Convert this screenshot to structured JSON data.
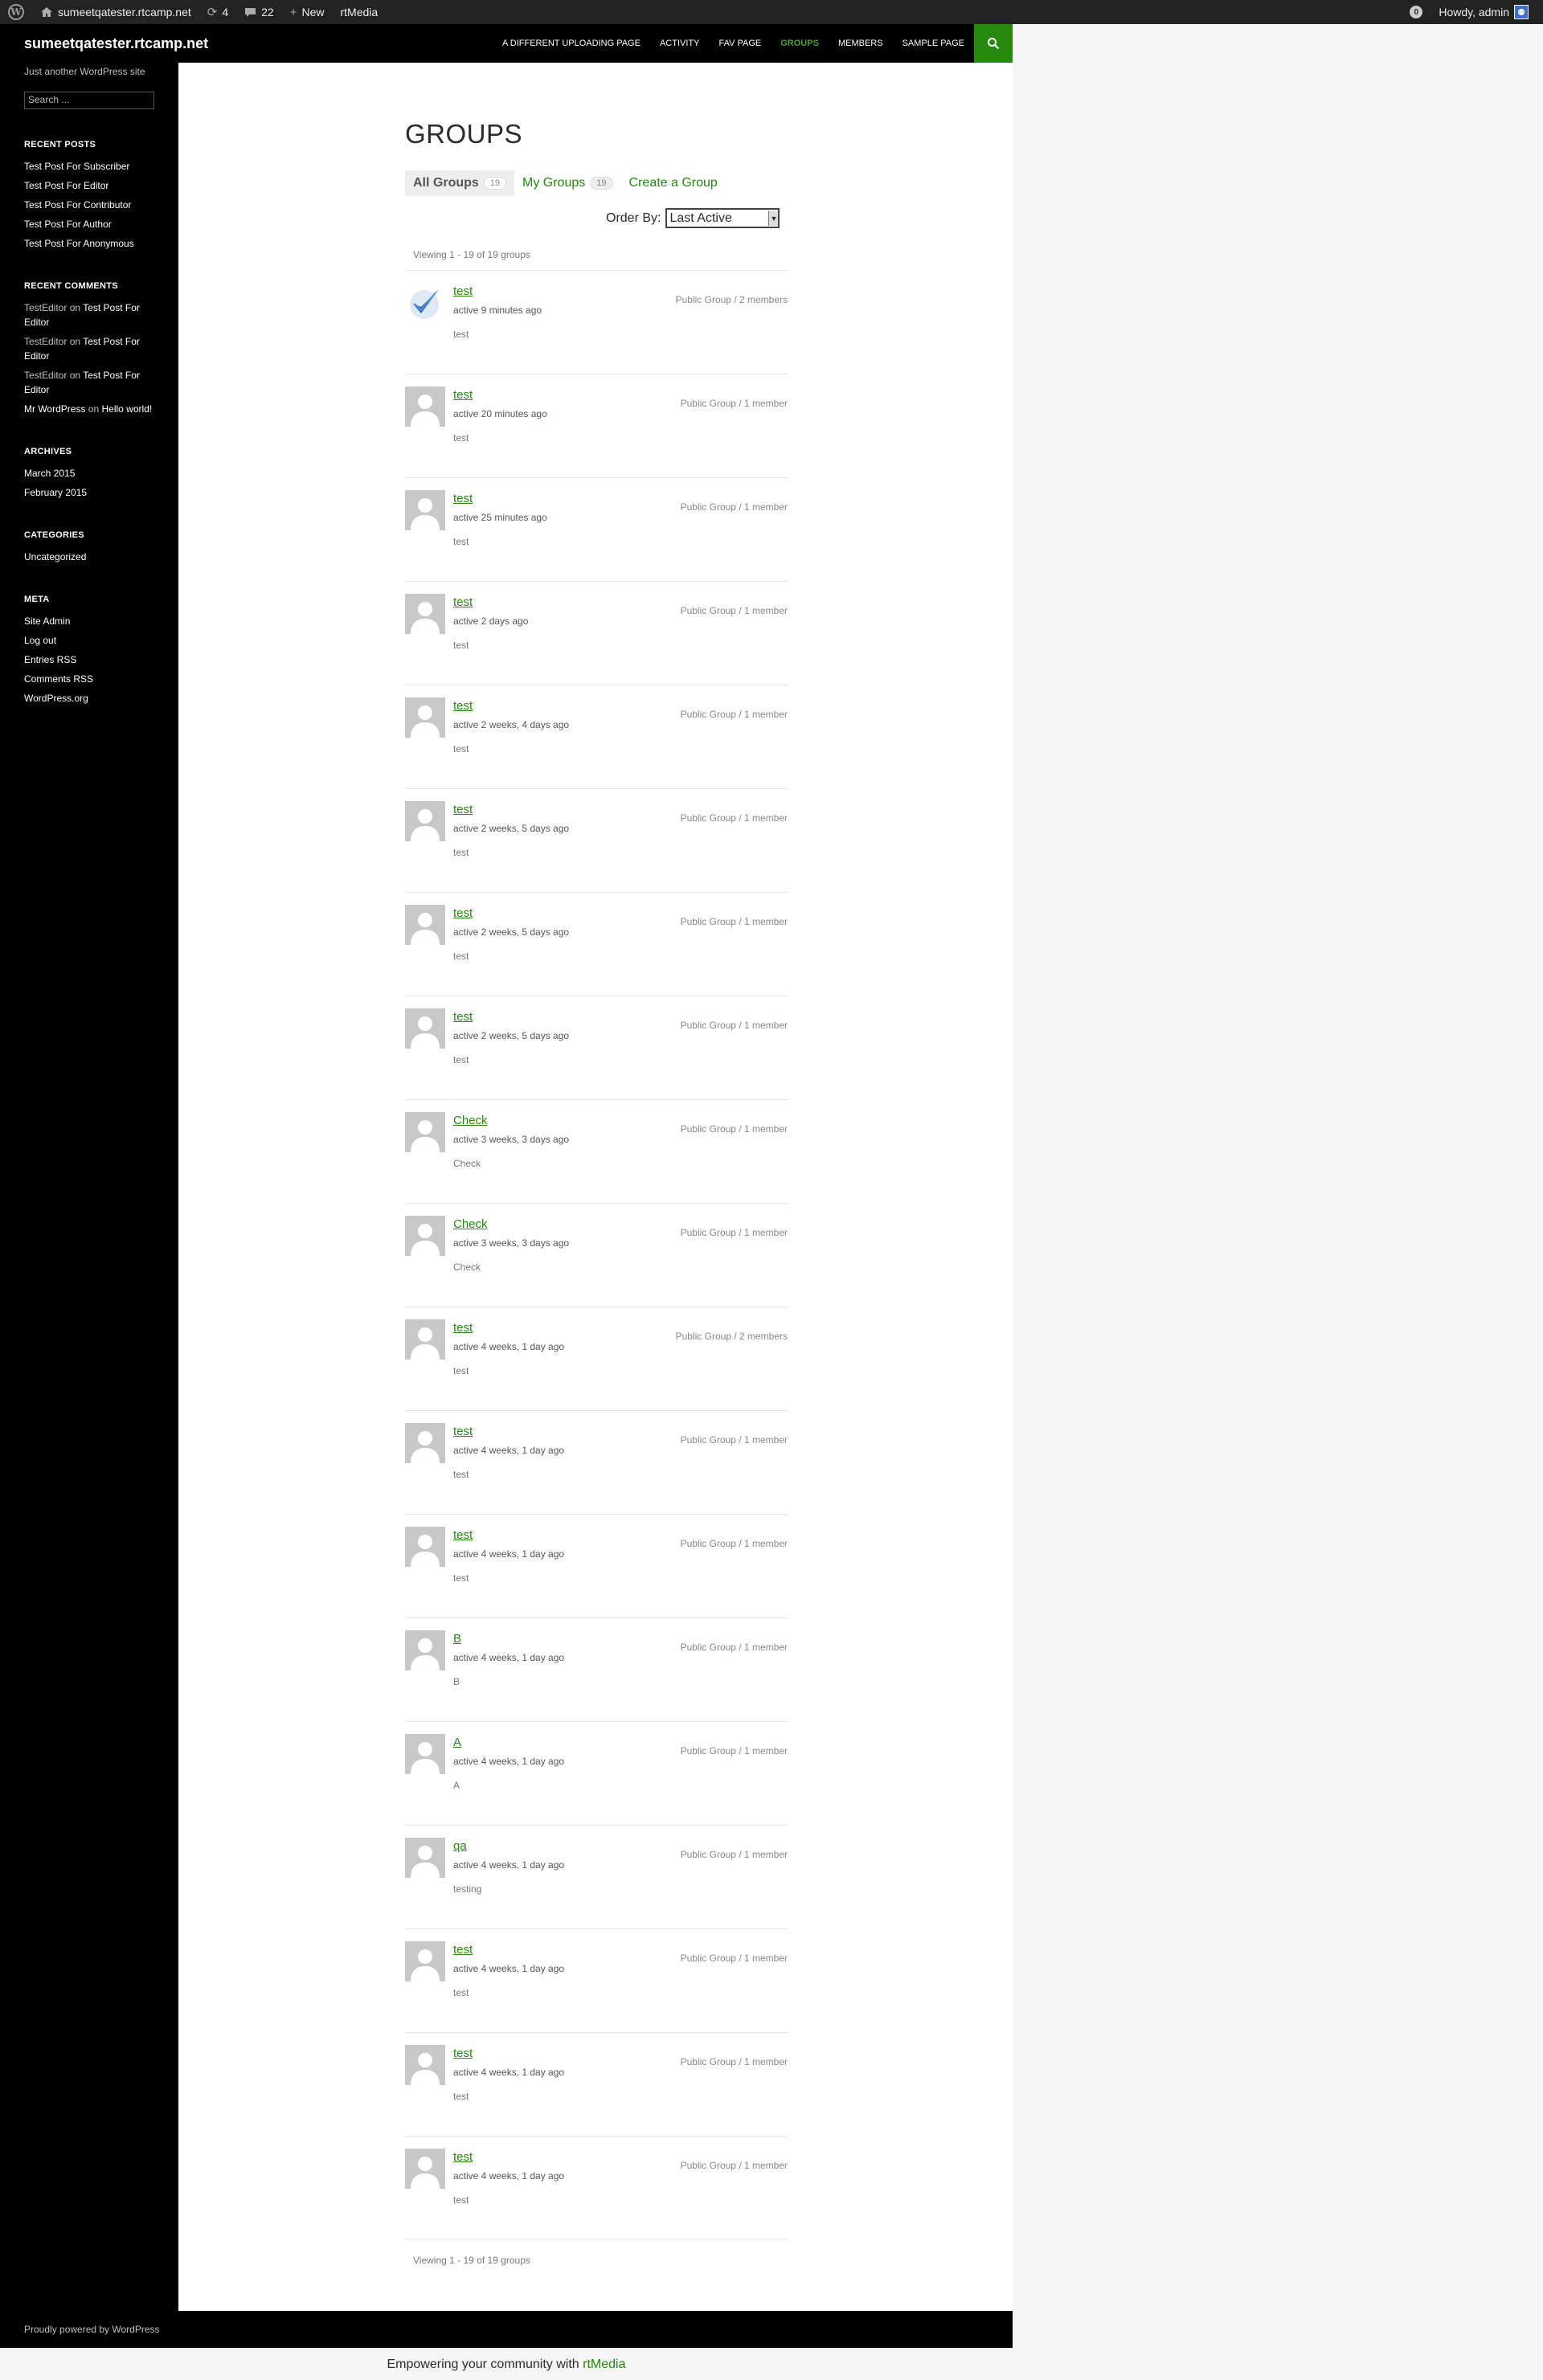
{
  "admin_bar": {
    "site": "sumeetqatester.rtcamp.net",
    "updates": "4",
    "comments": "22",
    "new": "New",
    "plugin": "rtMedia",
    "howdy": "Howdy, admin"
  },
  "header": {
    "site_title": "sumeetqatester.rtcamp.net",
    "nav": [
      "A DIFFERENT UPLOADING PAGE",
      "ACTIVITY",
      "FAV PAGE",
      "GROUPS",
      "MEMBERS",
      "SAMPLE PAGE"
    ],
    "current_nav": "GROUPS"
  },
  "sidebar": {
    "description": "Just another WordPress site",
    "search_placeholder": "Search ...",
    "recent_posts_title": "RECENT POSTS",
    "recent_posts": [
      "Test Post For Subscriber",
      "Test Post For Editor",
      "Test Post For Contributor",
      "Test Post For Author",
      "Test Post For Anonymous"
    ],
    "recent_comments_title": "RECENT COMMENTS",
    "recent_comments": [
      {
        "author": "TestEditor",
        "on": "on",
        "post": "Test Post For Editor"
      },
      {
        "author": "TestEditor",
        "on": "on",
        "post": "Test Post For Editor"
      },
      {
        "author": "TestEditor",
        "on": "on",
        "post": "Test Post For Editor"
      },
      {
        "author": "Mr WordPress",
        "on": "on",
        "post": "Hello world!"
      }
    ],
    "archives_title": "ARCHIVES",
    "archives": [
      "March 2015",
      "February 2015"
    ],
    "categories_title": "CATEGORIES",
    "categories": [
      "Uncategorized"
    ],
    "meta_title": "META",
    "meta": [
      "Site Admin",
      "Log out",
      "Entries RSS",
      "Comments RSS",
      "WordPress.org"
    ]
  },
  "main": {
    "title": "GROUPS",
    "tabs": [
      {
        "label": "All Groups",
        "count": "19"
      },
      {
        "label": "My Groups",
        "count": "19"
      },
      {
        "label": "Create a Group",
        "count": ""
      }
    ],
    "order_by_label": "Order By:",
    "order_by_value": "Last Active",
    "pagination_top": "Viewing 1 - 19 of 19 groups",
    "pagination_bottom": "Viewing 1 - 19 of 19 groups",
    "groups": [
      {
        "name": "test",
        "active": "active 9 minutes ago",
        "desc": "test",
        "meta": "Public Group / 2 members",
        "avatar": "custom"
      },
      {
        "name": "test",
        "active": "active 20 minutes ago",
        "desc": "test",
        "meta": "Public Group / 1 member",
        "avatar": "default"
      },
      {
        "name": "test",
        "active": "active 25 minutes ago",
        "desc": "test",
        "meta": "Public Group / 1 member",
        "avatar": "default"
      },
      {
        "name": "test",
        "active": "active 2 days ago",
        "desc": "test",
        "meta": "Public Group / 1 member",
        "avatar": "default"
      },
      {
        "name": "test",
        "active": "active 2 weeks, 4 days ago",
        "desc": "test",
        "meta": "Public Group / 1 member",
        "avatar": "default"
      },
      {
        "name": "test",
        "active": "active 2 weeks, 5 days ago",
        "desc": "test",
        "meta": "Public Group / 1 member",
        "avatar": "default"
      },
      {
        "name": "test",
        "active": "active 2 weeks, 5 days ago",
        "desc": "test",
        "meta": "Public Group / 1 member",
        "avatar": "default"
      },
      {
        "name": "test",
        "active": "active 2 weeks, 5 days ago",
        "desc": "test",
        "meta": "Public Group / 1 member",
        "avatar": "default"
      },
      {
        "name": "Check",
        "active": "active 3 weeks, 3 days ago",
        "desc": "Check",
        "meta": "Public Group / 1 member",
        "avatar": "default"
      },
      {
        "name": "Check",
        "active": "active 3 weeks, 3 days ago",
        "desc": "Check",
        "meta": "Public Group / 1 member",
        "avatar": "default"
      },
      {
        "name": "test",
        "active": "active 4 weeks, 1 day ago",
        "desc": "test",
        "meta": "Public Group / 2 members",
        "avatar": "default"
      },
      {
        "name": "test",
        "active": "active 4 weeks, 1 day ago",
        "desc": "test",
        "meta": "Public Group / 1 member",
        "avatar": "default"
      },
      {
        "name": "test",
        "active": "active 4 weeks, 1 day ago",
        "desc": "test",
        "meta": "Public Group / 1 member",
        "avatar": "default"
      },
      {
        "name": "B",
        "active": "active 4 weeks, 1 day ago",
        "desc": "B",
        "meta": "Public Group / 1 member",
        "avatar": "default"
      },
      {
        "name": "A",
        "active": "active 4 weeks, 1 day ago",
        "desc": "A",
        "meta": "Public Group / 1 member",
        "avatar": "default"
      },
      {
        "name": "qa",
        "active": "active 4 weeks, 1 day ago",
        "desc": "testing",
        "meta": "Public Group / 1 member",
        "avatar": "default"
      },
      {
        "name": "test",
        "active": "active 4 weeks, 1 day ago",
        "desc": "test",
        "meta": "Public Group / 1 member",
        "avatar": "default"
      },
      {
        "name": "test",
        "active": "active 4 weeks, 1 day ago",
        "desc": "test",
        "meta": "Public Group / 1 member",
        "avatar": "default"
      },
      {
        "name": "test",
        "active": "active 4 weeks, 1 day ago",
        "desc": "test",
        "meta": "Public Group / 1 member",
        "avatar": "default"
      }
    ]
  },
  "footer": {
    "credit": "Proudly powered by WordPress",
    "rtmedia_text": "Empowering your community with",
    "rtmedia_link": "rtMedia"
  },
  "colors": {
    "accent": "#24890d",
    "nav_current": "#41a62a",
    "header_bg": "#000000",
    "admin_bar_bg": "#222222"
  },
  "icons": {
    "admin_logo": "wordpress-logo-icon",
    "updates": "refresh-icon",
    "comments": "comment-bubble-icon",
    "new": "plus-icon",
    "search": "search-icon"
  }
}
